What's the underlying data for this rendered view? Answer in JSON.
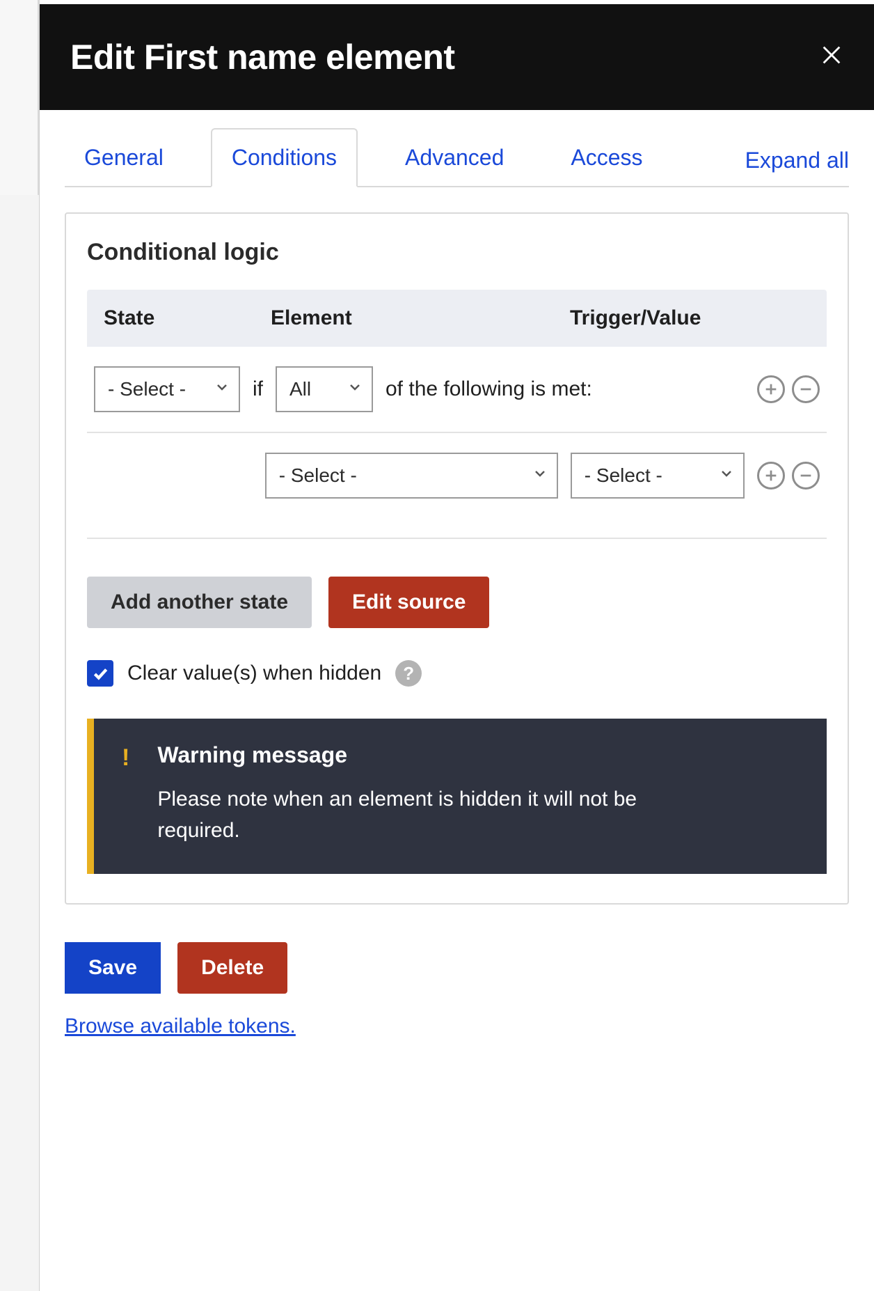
{
  "header": {
    "title": "Edit First name element"
  },
  "tabs": {
    "general": "General",
    "conditions": "Conditions",
    "advanced": "Advanced",
    "access": "Access",
    "expand_all": "Expand all"
  },
  "panel": {
    "title": "Conditional logic",
    "columns": {
      "state": "State",
      "element": "Element",
      "trigger": "Trigger/Value"
    },
    "state_select_placeholder": "- Select -",
    "if_text": "if",
    "all_select_value": "All",
    "met_text": "of the following is met:",
    "element_select_placeholder": "- Select -",
    "trigger_select_placeholder": "- Select -",
    "add_state_label": "Add another state",
    "edit_source_label": "Edit source",
    "clear_hidden_label": "Clear value(s) when hidden",
    "help_symbol": "?",
    "warning": {
      "title": "Warning message",
      "body": "Please note when an element is hidden it will not be required."
    }
  },
  "footer": {
    "save": "Save",
    "delete": "Delete",
    "tokens": "Browse available tokens."
  }
}
